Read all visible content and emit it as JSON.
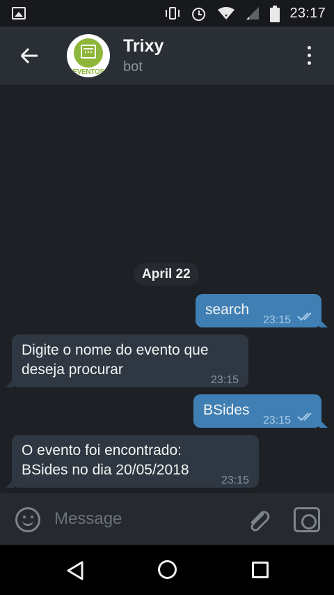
{
  "status_bar": {
    "time": "23:17",
    "icons": [
      "gallery-icon",
      "vibrate-icon",
      "alarm-icon",
      "wifi-icon",
      "signal-icon",
      "battery-icon"
    ]
  },
  "header": {
    "title": "Trixy",
    "subtitle": "bot",
    "avatar_text": "EVENTOS"
  },
  "chat": {
    "date": "April 22",
    "messages": [
      {
        "direction": "out",
        "text": "search",
        "time": "23:15",
        "status": "read"
      },
      {
        "direction": "in",
        "text": "Digite o nome do evento que\ndeseja procurar",
        "time": "23:15"
      },
      {
        "direction": "out",
        "text": "BSides",
        "time": "23:15",
        "status": "read"
      },
      {
        "direction": "in",
        "text": "O evento foi encontrado:\nBSides no dia 20/05/2018",
        "time": "23:15"
      }
    ]
  },
  "input": {
    "placeholder": "Message",
    "value": ""
  },
  "colors": {
    "outgoing_bubble": "#3f7fb3",
    "incoming_bubble": "#2f3742",
    "header_bg": "#2a2f35",
    "chat_bg": "#1d2024",
    "avatar_accent": "#8db63a"
  }
}
